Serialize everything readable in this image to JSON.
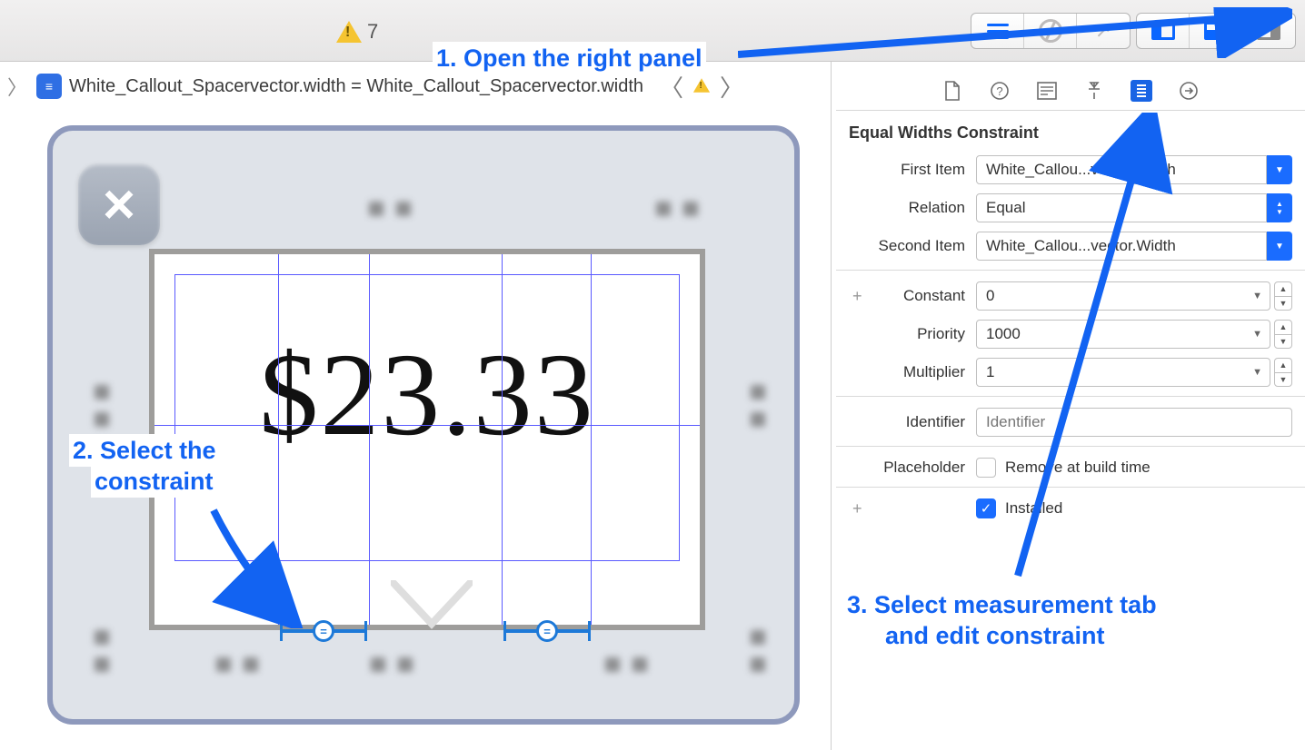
{
  "toolbar": {
    "warning_count": "7"
  },
  "jumpbar": {
    "constraint_text": "White_Callout_Spacervector.width = White_Callout_Spacervector.width"
  },
  "canvas": {
    "price_label": "$23.33"
  },
  "inspector": {
    "title": "Equal Widths Constraint",
    "labels": {
      "first_item": "First Item",
      "relation": "Relation",
      "second_item": "Second Item",
      "constant": "Constant",
      "priority": "Priority",
      "multiplier": "Multiplier",
      "identifier": "Identifier",
      "placeholder": "Placeholder",
      "placeholder_text": "Remove at build time",
      "installed": "Installed"
    },
    "values": {
      "first_item": "White_Callou...vector.Width",
      "relation": "Equal",
      "second_item": "White_Callou...vector.Width",
      "constant": "0",
      "priority": "1000",
      "multiplier": "1",
      "identifier_placeholder": "Identifier",
      "remove_at_build": false,
      "installed": true
    }
  },
  "annotations": {
    "step1": "1. Open the right panel",
    "step2a": "2. Select the",
    "step2b": "constraint",
    "step3a": "3. Select measurement tab",
    "step3b": "and edit constraint"
  }
}
